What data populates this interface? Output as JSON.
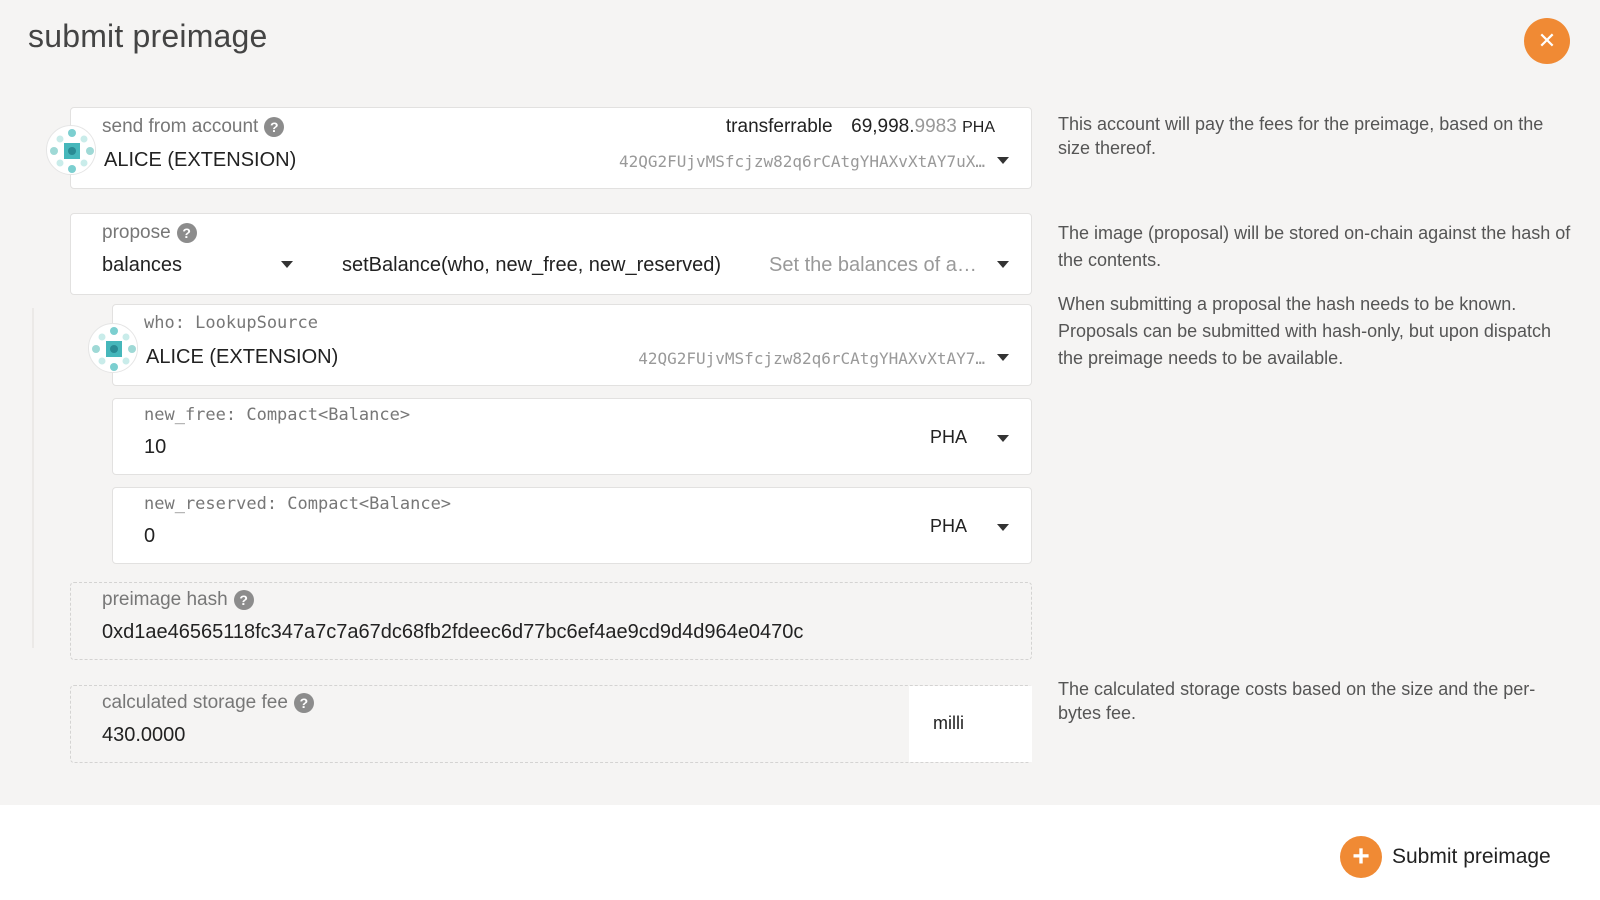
{
  "modal": {
    "title": "submit preimage",
    "close_icon": "close-icon"
  },
  "account": {
    "label": "send from account",
    "name": "ALICE (EXTENSION)",
    "address": "42QG2FUjvMSfcjzw82q6rCAtgYHAXvXtAY7uX…",
    "transferrable_label": "transferrable",
    "balance_main": "69,998.",
    "balance_decimal": "9983",
    "balance_unit": "PHA",
    "help": "This account will pay the fees for the preimage, based on the size thereof."
  },
  "propose": {
    "label": "propose",
    "section": "balances",
    "method": "setBalance(who, new_free, new_reserved)",
    "method_desc": "Set the balances of a…",
    "help1": "The image (proposal) will be stored on-chain against the hash of the contents.",
    "help2": "When submitting a proposal the hash needs to be known. Proposals can be submitted with hash-only, but upon dispatch the preimage needs to be available."
  },
  "who": {
    "label": "who: LookupSource",
    "name": "ALICE (EXTENSION)",
    "address": "42QG2FUjvMSfcjzw82q6rCAtgYHAXvXtAY7…"
  },
  "new_free": {
    "label": "new_free: Compact<Balance>",
    "value": "10",
    "unit": "PHA"
  },
  "new_reserved": {
    "label": "new_reserved: Compact<Balance>",
    "value": "0",
    "unit": "PHA"
  },
  "preimage_hash": {
    "label": "preimage hash",
    "value": "0xd1ae46565118fc347a7c7a67dc68fb2fdeec6d77bc6ef4ae9cd9d4d964e0470c"
  },
  "storage_fee": {
    "label": "calculated storage fee",
    "value": "430.0000",
    "unit": "milli",
    "help": "The calculated storage costs based on the size and the per-bytes fee."
  },
  "footer": {
    "submit_label": "Submit preimage"
  },
  "colors": {
    "accent": "#f08a34",
    "background": "#f5f4f3"
  }
}
